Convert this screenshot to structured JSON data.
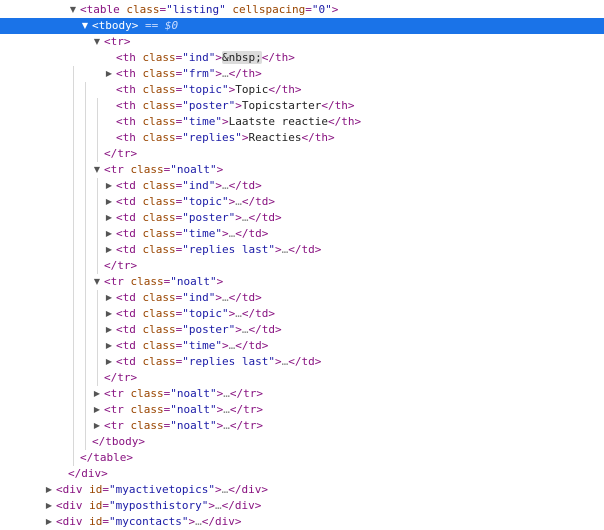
{
  "rows": [
    {
      "i": 3,
      "arrow": "open",
      "parts": [
        [
          "tag",
          "<table"
        ],
        [
          "txt",
          " "
        ],
        [
          "an",
          "class"
        ],
        [
          "tag",
          "="
        ],
        [
          "av",
          "\"listing\""
        ],
        [
          "txt",
          " "
        ],
        [
          "an",
          "cellspacing"
        ],
        [
          "tag",
          "="
        ],
        [
          "av",
          "\"0\""
        ],
        [
          "tag",
          ">"
        ]
      ]
    },
    {
      "i": 4,
      "arrow": "open",
      "selected": true,
      "parts": [
        [
          "tag",
          "<tbody>"
        ],
        [
          "eq",
          " == $0"
        ]
      ]
    },
    {
      "i": 5,
      "arrow": "open",
      "parts": [
        [
          "tag",
          "<tr>"
        ]
      ]
    },
    {
      "i": 6,
      "arrow": "none",
      "parts": [
        [
          "tag",
          "<th"
        ],
        [
          "txt",
          " "
        ],
        [
          "an",
          "class"
        ],
        [
          "tag",
          "="
        ],
        [
          "av",
          "\"ind\""
        ],
        [
          "tag",
          ">"
        ],
        [
          "ent",
          "&nbsp;"
        ],
        [
          "tag",
          "</th>"
        ]
      ]
    },
    {
      "i": 6,
      "arrow": "closed",
      "parts": [
        [
          "tag",
          "<th"
        ],
        [
          "txt",
          " "
        ],
        [
          "an",
          "class"
        ],
        [
          "tag",
          "="
        ],
        [
          "av",
          "\"frm\""
        ],
        [
          "tag",
          ">"
        ],
        [
          "dim",
          "…"
        ],
        [
          "tag",
          "</th>"
        ]
      ]
    },
    {
      "i": 6,
      "arrow": "none",
      "parts": [
        [
          "tag",
          "<th"
        ],
        [
          "txt",
          " "
        ],
        [
          "an",
          "class"
        ],
        [
          "tag",
          "="
        ],
        [
          "av",
          "\"topic\""
        ],
        [
          "tag",
          ">"
        ],
        [
          "txt",
          "Topic"
        ],
        [
          "tag",
          "</th>"
        ]
      ]
    },
    {
      "i": 6,
      "arrow": "none",
      "parts": [
        [
          "tag",
          "<th"
        ],
        [
          "txt",
          " "
        ],
        [
          "an",
          "class"
        ],
        [
          "tag",
          "="
        ],
        [
          "av",
          "\"poster\""
        ],
        [
          "tag",
          ">"
        ],
        [
          "txt",
          "Topicstarter"
        ],
        [
          "tag",
          "</th>"
        ]
      ]
    },
    {
      "i": 6,
      "arrow": "none",
      "parts": [
        [
          "tag",
          "<th"
        ],
        [
          "txt",
          " "
        ],
        [
          "an",
          "class"
        ],
        [
          "tag",
          "="
        ],
        [
          "av",
          "\"time\""
        ],
        [
          "tag",
          ">"
        ],
        [
          "txt",
          "Laatste reactie"
        ],
        [
          "tag",
          "</th>"
        ]
      ]
    },
    {
      "i": 6,
      "arrow": "none",
      "parts": [
        [
          "tag",
          "<th"
        ],
        [
          "txt",
          " "
        ],
        [
          "an",
          "class"
        ],
        [
          "tag",
          "="
        ],
        [
          "av",
          "\"replies\""
        ],
        [
          "tag",
          ">"
        ],
        [
          "txt",
          "Reacties"
        ],
        [
          "tag",
          "</th>"
        ]
      ]
    },
    {
      "i": 5,
      "arrow": "none",
      "parts": [
        [
          "tag",
          "</tr>"
        ]
      ]
    },
    {
      "i": 5,
      "arrow": "open",
      "parts": [
        [
          "tag",
          "<tr"
        ],
        [
          "txt",
          " "
        ],
        [
          "an",
          "class"
        ],
        [
          "tag",
          "="
        ],
        [
          "av",
          "\"noalt\""
        ],
        [
          "tag",
          ">"
        ]
      ]
    },
    {
      "i": 6,
      "arrow": "closed",
      "parts": [
        [
          "tag",
          "<td"
        ],
        [
          "txt",
          " "
        ],
        [
          "an",
          "class"
        ],
        [
          "tag",
          "="
        ],
        [
          "av",
          "\"ind\""
        ],
        [
          "tag",
          ">"
        ],
        [
          "dim",
          "…"
        ],
        [
          "tag",
          "</td>"
        ]
      ]
    },
    {
      "i": 6,
      "arrow": "closed",
      "parts": [
        [
          "tag",
          "<td"
        ],
        [
          "txt",
          " "
        ],
        [
          "an",
          "class"
        ],
        [
          "tag",
          "="
        ],
        [
          "av",
          "\"topic\""
        ],
        [
          "tag",
          ">"
        ],
        [
          "dim",
          "…"
        ],
        [
          "tag",
          "</td>"
        ]
      ]
    },
    {
      "i": 6,
      "arrow": "closed",
      "parts": [
        [
          "tag",
          "<td"
        ],
        [
          "txt",
          " "
        ],
        [
          "an",
          "class"
        ],
        [
          "tag",
          "="
        ],
        [
          "av",
          "\"poster\""
        ],
        [
          "tag",
          ">"
        ],
        [
          "dim",
          "…"
        ],
        [
          "tag",
          "</td>"
        ]
      ]
    },
    {
      "i": 6,
      "arrow": "closed",
      "parts": [
        [
          "tag",
          "<td"
        ],
        [
          "txt",
          " "
        ],
        [
          "an",
          "class"
        ],
        [
          "tag",
          "="
        ],
        [
          "av",
          "\"time\""
        ],
        [
          "tag",
          ">"
        ],
        [
          "dim",
          "…"
        ],
        [
          "tag",
          "</td>"
        ]
      ]
    },
    {
      "i": 6,
      "arrow": "closed",
      "parts": [
        [
          "tag",
          "<td"
        ],
        [
          "txt",
          " "
        ],
        [
          "an",
          "class"
        ],
        [
          "tag",
          "="
        ],
        [
          "av",
          "\"replies last\""
        ],
        [
          "tag",
          ">"
        ],
        [
          "dim",
          "…"
        ],
        [
          "tag",
          "</td>"
        ]
      ]
    },
    {
      "i": 5,
      "arrow": "none",
      "parts": [
        [
          "tag",
          "</tr>"
        ]
      ]
    },
    {
      "i": 5,
      "arrow": "open",
      "parts": [
        [
          "tag",
          "<tr"
        ],
        [
          "txt",
          " "
        ],
        [
          "an",
          "class"
        ],
        [
          "tag",
          "="
        ],
        [
          "av",
          "\"noalt\""
        ],
        [
          "tag",
          ">"
        ]
      ]
    },
    {
      "i": 6,
      "arrow": "closed",
      "parts": [
        [
          "tag",
          "<td"
        ],
        [
          "txt",
          " "
        ],
        [
          "an",
          "class"
        ],
        [
          "tag",
          "="
        ],
        [
          "av",
          "\"ind\""
        ],
        [
          "tag",
          ">"
        ],
        [
          "dim",
          "…"
        ],
        [
          "tag",
          "</td>"
        ]
      ]
    },
    {
      "i": 6,
      "arrow": "closed",
      "parts": [
        [
          "tag",
          "<td"
        ],
        [
          "txt",
          " "
        ],
        [
          "an",
          "class"
        ],
        [
          "tag",
          "="
        ],
        [
          "av",
          "\"topic\""
        ],
        [
          "tag",
          ">"
        ],
        [
          "dim",
          "…"
        ],
        [
          "tag",
          "</td>"
        ]
      ]
    },
    {
      "i": 6,
      "arrow": "closed",
      "parts": [
        [
          "tag",
          "<td"
        ],
        [
          "txt",
          " "
        ],
        [
          "an",
          "class"
        ],
        [
          "tag",
          "="
        ],
        [
          "av",
          "\"poster\""
        ],
        [
          "tag",
          ">"
        ],
        [
          "dim",
          "…"
        ],
        [
          "tag",
          "</td>"
        ]
      ]
    },
    {
      "i": 6,
      "arrow": "closed",
      "parts": [
        [
          "tag",
          "<td"
        ],
        [
          "txt",
          " "
        ],
        [
          "an",
          "class"
        ],
        [
          "tag",
          "="
        ],
        [
          "av",
          "\"time\""
        ],
        [
          "tag",
          ">"
        ],
        [
          "dim",
          "…"
        ],
        [
          "tag",
          "</td>"
        ]
      ]
    },
    {
      "i": 6,
      "arrow": "closed",
      "parts": [
        [
          "tag",
          "<td"
        ],
        [
          "txt",
          " "
        ],
        [
          "an",
          "class"
        ],
        [
          "tag",
          "="
        ],
        [
          "av",
          "\"replies last\""
        ],
        [
          "tag",
          ">"
        ],
        [
          "dim",
          "…"
        ],
        [
          "tag",
          "</td>"
        ]
      ]
    },
    {
      "i": 5,
      "arrow": "none",
      "parts": [
        [
          "tag",
          "</tr>"
        ]
      ]
    },
    {
      "i": 5,
      "arrow": "closed",
      "parts": [
        [
          "tag",
          "<tr"
        ],
        [
          "txt",
          " "
        ],
        [
          "an",
          "class"
        ],
        [
          "tag",
          "="
        ],
        [
          "av",
          "\"noalt\""
        ],
        [
          "tag",
          ">"
        ],
        [
          "dim",
          "…"
        ],
        [
          "tag",
          "</tr>"
        ]
      ]
    },
    {
      "i": 5,
      "arrow": "closed",
      "parts": [
        [
          "tag",
          "<tr"
        ],
        [
          "txt",
          " "
        ],
        [
          "an",
          "class"
        ],
        [
          "tag",
          "="
        ],
        [
          "av",
          "\"noalt\""
        ],
        [
          "tag",
          ">"
        ],
        [
          "dim",
          "…"
        ],
        [
          "tag",
          "</tr>"
        ]
      ]
    },
    {
      "i": 5,
      "arrow": "closed",
      "parts": [
        [
          "tag",
          "<tr"
        ],
        [
          "txt",
          " "
        ],
        [
          "an",
          "class"
        ],
        [
          "tag",
          "="
        ],
        [
          "av",
          "\"noalt\""
        ],
        [
          "tag",
          ">"
        ],
        [
          "dim",
          "…"
        ],
        [
          "tag",
          "</tr>"
        ]
      ]
    },
    {
      "i": 4,
      "arrow": "none",
      "parts": [
        [
          "tag",
          "</tbody>"
        ]
      ]
    },
    {
      "i": 3,
      "arrow": "none",
      "parts": [
        [
          "tag",
          "</table>"
        ]
      ]
    },
    {
      "i": 2,
      "arrow": "none",
      "parts": [
        [
          "tag",
          "</div>"
        ]
      ]
    },
    {
      "i": 1,
      "arrow": "closed",
      "parts": [
        [
          "tag",
          "<div"
        ],
        [
          "txt",
          " "
        ],
        [
          "an",
          "id"
        ],
        [
          "tag",
          "="
        ],
        [
          "av",
          "\"myactivetopics\""
        ],
        [
          "tag",
          ">"
        ],
        [
          "dim",
          "…"
        ],
        [
          "tag",
          "</div>"
        ]
      ]
    },
    {
      "i": 1,
      "arrow": "closed",
      "parts": [
        [
          "tag",
          "<div"
        ],
        [
          "txt",
          " "
        ],
        [
          "an",
          "id"
        ],
        [
          "tag",
          "="
        ],
        [
          "av",
          "\"myposthistory\""
        ],
        [
          "tag",
          ">"
        ],
        [
          "dim",
          "…"
        ],
        [
          "tag",
          "</div>"
        ]
      ]
    },
    {
      "i": 1,
      "arrow": "closed",
      "parts": [
        [
          "tag",
          "<div"
        ],
        [
          "txt",
          " "
        ],
        [
          "an",
          "id"
        ],
        [
          "tag",
          "="
        ],
        [
          "av",
          "\"mycontacts\""
        ],
        [
          "tag",
          ">"
        ],
        [
          "dim",
          "…"
        ],
        [
          "tag",
          "</div>"
        ]
      ]
    }
  ]
}
